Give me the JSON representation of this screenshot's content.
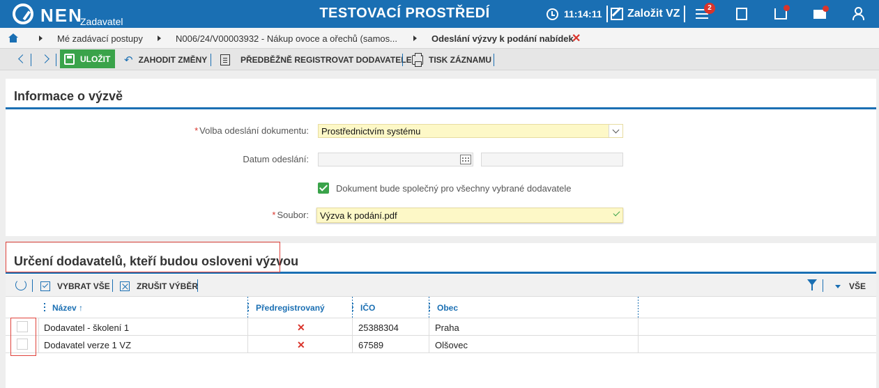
{
  "app": {
    "logo_text": "NEN",
    "logo_sub": "Zadavatel",
    "environment": "TESTOVACÍ PROSTŘEDÍ",
    "time": "11:14:11",
    "create_label": "Založit VZ",
    "notification_count": "2"
  },
  "breadcrumb": {
    "items": [
      "Mé zadávací postupy",
      "N006/24/V00003932 - Nákup ovoce a ořechů (samos...",
      "Odeslání výzvy k podání nabídek"
    ],
    "close": "✕"
  },
  "toolbar": {
    "save": "ULOŽIT",
    "discard": "ZAHODIT ZMĚNY",
    "preregister": "PŘEDBĚŽNĚ REGISTROVAT DODAVATELE",
    "print": "TISK ZÁZNAMU"
  },
  "info_panel": {
    "title": "Informace o výzvě",
    "send_choice_label": "Volba odeslání dokumentu:",
    "send_choice_value": "Prostřednictvím systému",
    "send_date_label": "Datum odeslání:",
    "send_date_value": "",
    "send_time_value": "",
    "shared_doc_label": "Dokument bude společný pro všechny vybrané dodavatele",
    "shared_doc_checked": true,
    "file_label": "Soubor:",
    "file_value": "Výzva k podání.pdf"
  },
  "supplier_panel": {
    "title": "Určení dodavatelů, kteří budou osloveni výzvou",
    "select_all": "VYBRAT VŠE",
    "clear_selection": "ZRUŠIT VÝBĚR",
    "view_all": "VŠE",
    "columns": [
      "Název ↑",
      "Předregistrovaný",
      "IČO",
      "Obec"
    ],
    "rows": [
      {
        "name": "Dodavatel - školení 1",
        "preregistered": "✕",
        "ico": "25388304",
        "city": "Praha"
      },
      {
        "name": "Dodavatel verze 1 VZ",
        "preregistered": "✕",
        "ico": "67589",
        "city": "Olšovec"
      }
    ]
  },
  "colors": {
    "brand_blue": "#1a6fb3",
    "save_green": "#3aa34a",
    "required_yellow": "#fdf8c7",
    "alert_red": "#d9342b"
  }
}
